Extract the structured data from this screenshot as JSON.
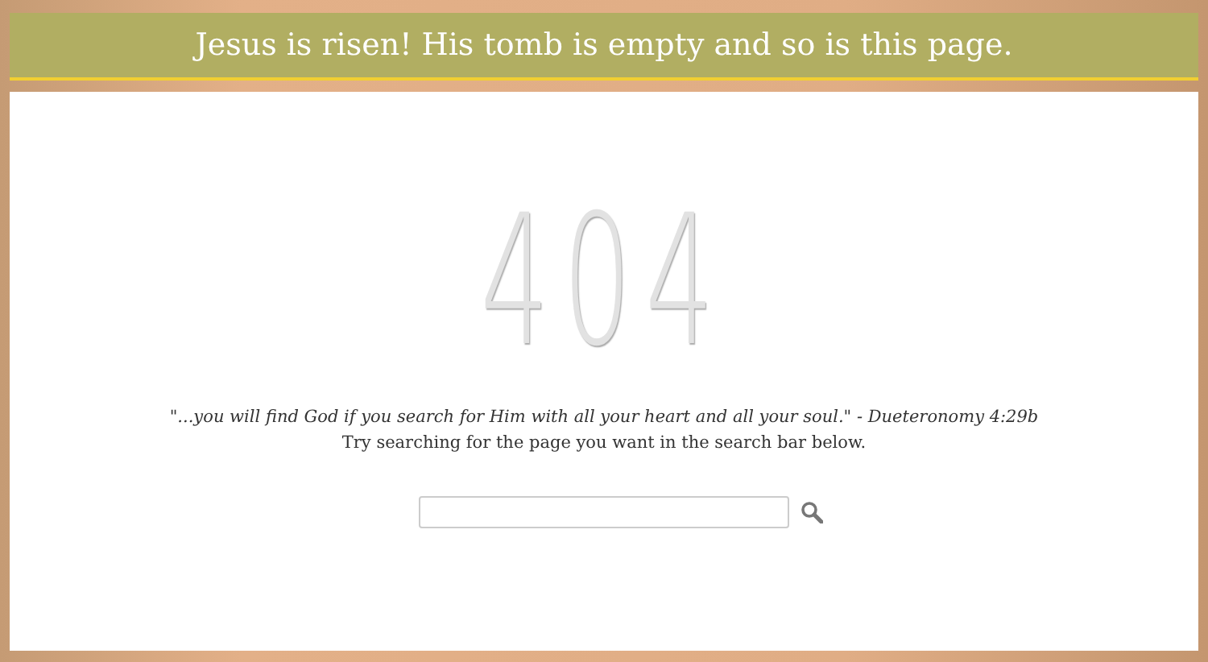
{
  "banner": {
    "title": "Jesus is risen! His tomb is empty and so is this page."
  },
  "error_code": "404",
  "quote": "\"...you will find God if you search for Him with all your heart and all your soul.\" - Dueteronomy 4:29b",
  "hint": "Try searching for the page you want in the search bar below.",
  "search": {
    "kind": "text-field"
  }
}
